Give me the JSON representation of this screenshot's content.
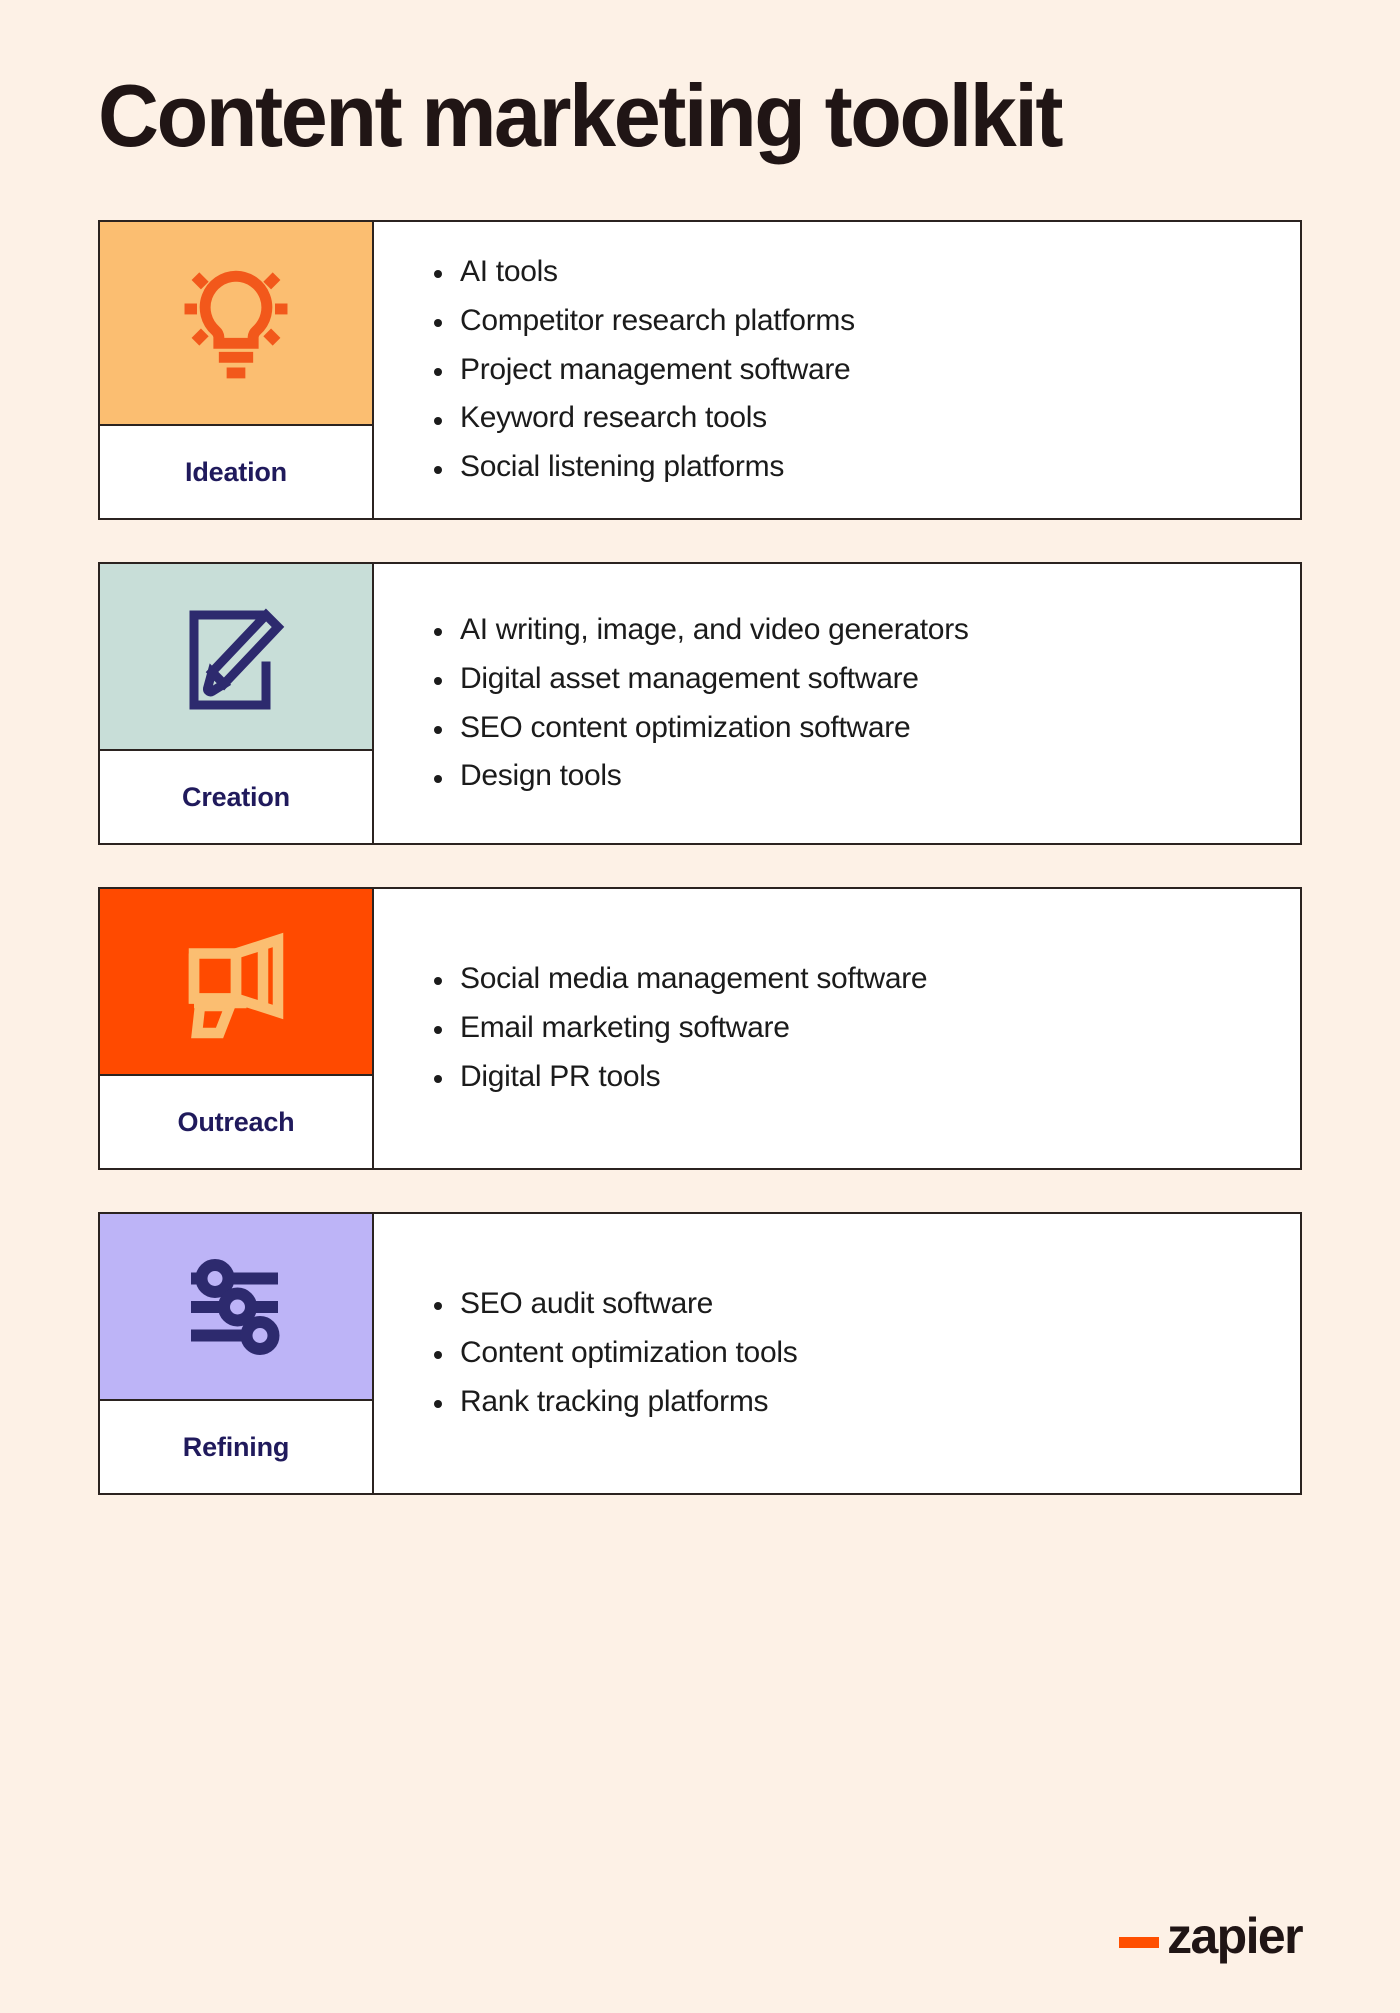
{
  "page": {
    "title": "Content marketing toolkit",
    "background_color": "#FDF1E6",
    "border_color": "#2b2320",
    "caption_color": "#201A5C",
    "body_text_color": "#1b1b1b"
  },
  "cards": [
    {
      "id": "ideation",
      "caption": "Ideation",
      "icon": "lightbulb-icon",
      "tile_color": "#FBBE71",
      "icon_color": "#F2581B",
      "items": [
        "AI tools",
        "Competitor research platforms",
        "Project management software",
        "Keyword research tools",
        "Social listening platforms"
      ]
    },
    {
      "id": "creation",
      "caption": "Creation",
      "icon": "pencil-document-icon",
      "tile_color": "#C8DED8",
      "icon_color": "#2D2A6E",
      "items": [
        "AI writing, image, and video generators",
        "Digital asset management software",
        "SEO content optimization software",
        "Design tools"
      ]
    },
    {
      "id": "outreach",
      "caption": "Outreach",
      "icon": "megaphone-icon",
      "tile_color": "#FF4A00",
      "icon_color": "#FBBE71",
      "items": [
        "Social media management software",
        "Email marketing software",
        "Digital PR tools"
      ]
    },
    {
      "id": "refining",
      "caption": "Refining",
      "icon": "sliders-icon",
      "tile_color": "#BDB4F7",
      "icon_color": "#2D2A6E",
      "items": [
        "SEO audit software",
        "Content optimization tools",
        "Rank tracking platforms"
      ]
    }
  ],
  "footer": {
    "logo_underscore": "underscore-mark",
    "logo_text": "zapier",
    "logo_accent_color": "#FF4F00",
    "logo_text_color": "#201515"
  }
}
